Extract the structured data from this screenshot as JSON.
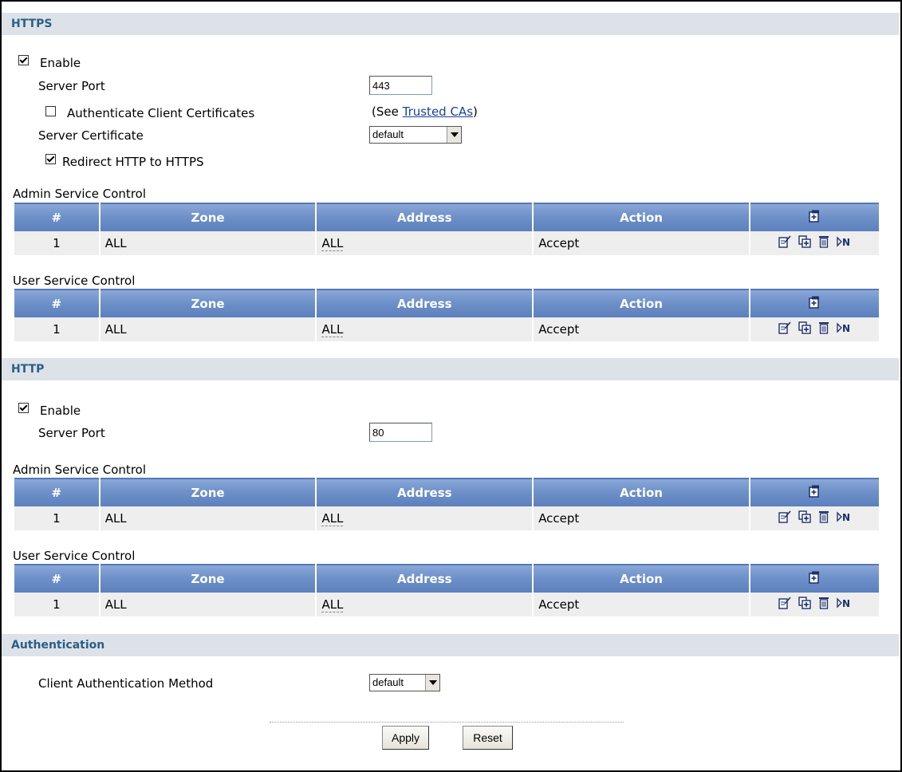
{
  "https": {
    "title": "HTTPS",
    "enable_label": "Enable",
    "server_port_label": "Server Port",
    "server_port_value": "443",
    "auth_client_cert_label": "Authenticate Client Certificates",
    "see_prefix": "(See ",
    "trusted_cas_link": "Trusted CAs",
    "see_suffix": ")",
    "server_cert_label": "Server Certificate",
    "server_cert_value": "default",
    "redirect_label": "Redirect HTTP to HTTPS",
    "admin_label": "Admin Service Control",
    "user_label": "User Service Control"
  },
  "http": {
    "title": "HTTP",
    "enable_label": "Enable",
    "server_port_label": "Server Port",
    "server_port_value": "80",
    "admin_label": "Admin Service Control",
    "user_label": "User Service Control"
  },
  "table": {
    "headers": [
      "#",
      "Zone",
      "Address",
      "Action"
    ],
    "row": {
      "num": "1",
      "zone": "ALL",
      "address": "ALL",
      "action": "Accept"
    }
  },
  "authentication": {
    "title": "Authentication",
    "method_label": "Client Authentication Method",
    "method_value": "default"
  },
  "buttons": {
    "apply": "Apply",
    "reset": "Reset"
  },
  "icons": [
    "add-icon",
    "edit-icon",
    "insert-icon",
    "delete-icon",
    "move-icon"
  ],
  "colors": {
    "section_bar": "#dde2e8",
    "section_title": "#2a5f86",
    "table_header": "#6f91c9",
    "table_row": "#eeeeee",
    "link": "#1a3f9c"
  }
}
